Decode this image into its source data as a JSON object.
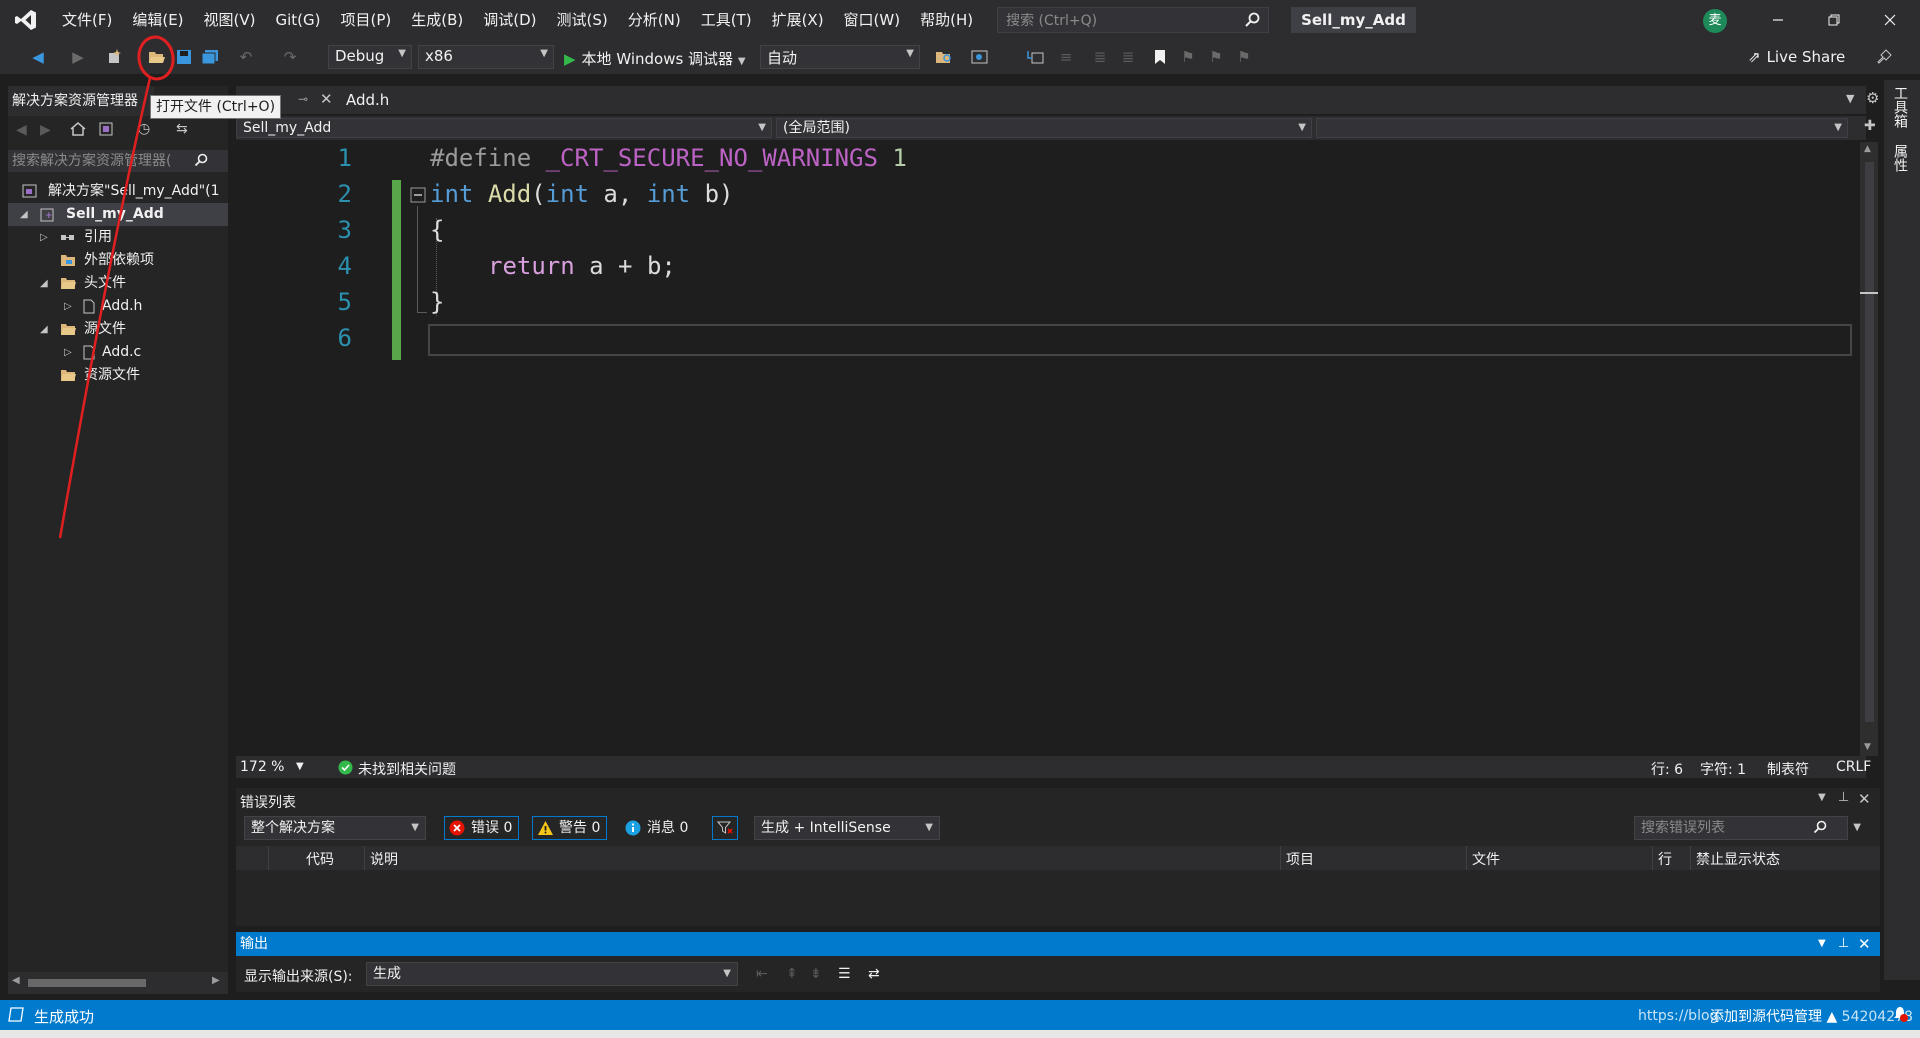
{
  "colors": {
    "chrome": "#2d2d30",
    "editor_bg": "#1e1e1e",
    "accent": "#007acc",
    "annotation": "#e02020",
    "keyword": "#569cd6",
    "line_number": "#2b91af"
  },
  "titlebar": {
    "menu": [
      "文件(F)",
      "编辑(E)",
      "视图(V)",
      "Git(G)",
      "项目(P)",
      "生成(B)",
      "调试(D)",
      "测试(S)",
      "分析(N)",
      "工具(T)",
      "扩展(X)",
      "窗口(W)",
      "帮助(H)"
    ],
    "search_placeholder": "搜索 (Ctrl+Q)",
    "solution_name": "Sell_my_Add",
    "avatar_initial": "麦"
  },
  "toolbar": {
    "configuration": "Debug",
    "platform": "x86",
    "debugger": "本地 Windows 调试器",
    "debug_mode": "自动",
    "live_share": "Live Share"
  },
  "tooltip": "打开文件 (Ctrl+O)",
  "solution_explorer": {
    "tab_title": "解决方案资源管理器",
    "search_placeholder": "搜索解决方案资源管理器(",
    "tree": [
      {
        "label": "解决方案\"Sell_my_Add\"(1"
      },
      {
        "label": "Sell_my_Add"
      },
      {
        "label": "引用"
      },
      {
        "label": "外部依赖项"
      },
      {
        "label": "头文件"
      },
      {
        "label": "Add.h"
      },
      {
        "label": "源文件"
      },
      {
        "label": "Add.c"
      },
      {
        "label": "资源文件"
      }
    ]
  },
  "editor": {
    "tab": "Add.h",
    "nav_project": "Sell_my_Add",
    "nav_scope": "(全局范围)",
    "line_numbers": [
      "1",
      "2",
      "3",
      "4",
      "5",
      "6"
    ],
    "code": {
      "l1_directive": "#define",
      "l1_macro": "_CRT_SECURE_NO_WARNINGS",
      "l1_value": "1",
      "l2_type": "int",
      "l2_name": "Add",
      "l2_open": "(",
      "l2_type_a": "int",
      "l2_param_a": " a, ",
      "l2_type_b": "int",
      "l2_param_b": " b)",
      "l3": "{",
      "l4_kw": "return",
      "l4_rest": " a + b;",
      "l5": "}"
    }
  },
  "editor_status": {
    "zoom": "172 %",
    "issues": "未找到相关问题",
    "line": "行: 6",
    "char": "字符: 1",
    "indent": "制表符",
    "eol": "CRLF"
  },
  "error_list": {
    "title": "错误列表",
    "scope": "整个解决方案",
    "errors": "错误 0",
    "warnings": "警告 0",
    "messages": "消息 0",
    "build_filter": "生成 + IntelliSense",
    "search_placeholder": "搜索错误列表",
    "columns": [
      "代码",
      "说明",
      "项目",
      "文件",
      "行",
      "禁止显示状态"
    ]
  },
  "output": {
    "title": "输出",
    "source_label": "显示输出来源(S):",
    "source_value": "生成"
  },
  "right_tabs": [
    "工具箱",
    "属性"
  ],
  "statusbar": {
    "text": "生成成功",
    "url_watermark": "https://blog",
    "scm": "添加到源代码管理 ▲",
    "scm_tail": "54204278"
  }
}
